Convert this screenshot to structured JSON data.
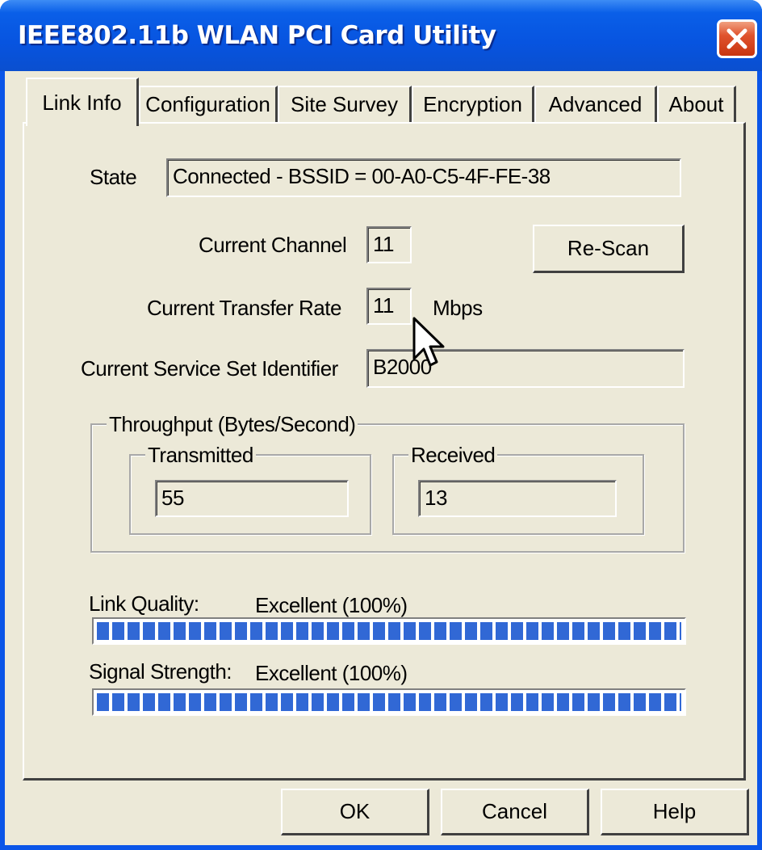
{
  "window": {
    "title": "IEEE802.11b WLAN PCI Card Utility",
    "title_bar_color": "#0754e0",
    "close_icon": "close-x-icon"
  },
  "tabs": [
    {
      "label": "Link Info",
      "active": true
    },
    {
      "label": "Configuration",
      "active": false
    },
    {
      "label": "Site Survey",
      "active": false
    },
    {
      "label": "Encryption",
      "active": false
    },
    {
      "label": "Advanced",
      "active": false
    },
    {
      "label": "About",
      "active": false
    }
  ],
  "link_info": {
    "state_label": "State",
    "state_value": "Connected - BSSID = 00-A0-C5-4F-FE-38",
    "channel_label": "Current Channel",
    "channel_value": "11",
    "rescan_label": "Re-Scan",
    "rate_label": "Current Transfer Rate",
    "rate_value": "11",
    "rate_unit": "Mbps",
    "ssid_label": "Current Service Set Identifier",
    "ssid_value": "B2000"
  },
  "throughput": {
    "caption": "Throughput (Bytes/Second)",
    "transmitted_caption": "Transmitted",
    "transmitted_value": "55",
    "received_caption": "Received",
    "received_value": "13"
  },
  "quality": {
    "link_quality_label": "Link Quality:",
    "link_quality_value": "Excellent (100%)",
    "link_quality_percent": 100,
    "signal_strength_label": "Signal Strength:",
    "signal_strength_value": "Excellent (100%)",
    "signal_strength_percent": 100,
    "meter_color": "#3168d5"
  },
  "buttons": {
    "ok_label": "OK",
    "cancel_label": "Cancel",
    "help_label": "Help"
  }
}
